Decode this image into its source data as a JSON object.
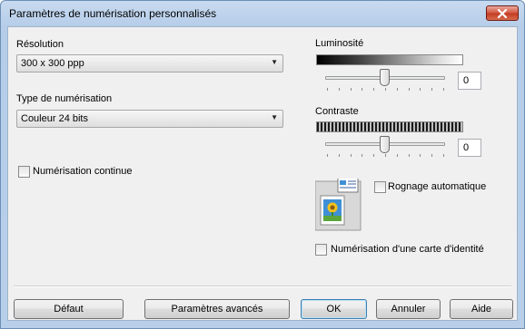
{
  "window": {
    "title": "Paramètres de numérisation personnalisés"
  },
  "resolution": {
    "label": "Résolution",
    "value": "300 x 300 ppp"
  },
  "scan_type": {
    "label": "Type de numérisation",
    "value": "Couleur 24 bits"
  },
  "continuous_scan": {
    "label": "Numérisation continue",
    "checked": false
  },
  "brightness": {
    "label": "Luminosité",
    "value": "0",
    "slider_level": 0.5
  },
  "contrast": {
    "label": "Contraste",
    "value": "0",
    "slider_level": 0.5
  },
  "auto_crop": {
    "label": "Rognage automatique",
    "checked": false
  },
  "id_card_scan": {
    "label": "Numérisation d'une carte d'identité",
    "checked": false
  },
  "buttons": {
    "default": "Défaut",
    "advanced": "Paramètres avancés",
    "ok": "OK",
    "cancel": "Annuler",
    "help": "Aide"
  },
  "icons": {
    "close": "close-icon",
    "dropdown": "chevron-down-icon",
    "document_scan": "document-scan-icon"
  },
  "colors": {
    "title_bar": "#b9d1ea",
    "close_button": "#c94a31",
    "dialog_background": "#f0f0f0",
    "default_button_border": "#3c7fb1"
  }
}
